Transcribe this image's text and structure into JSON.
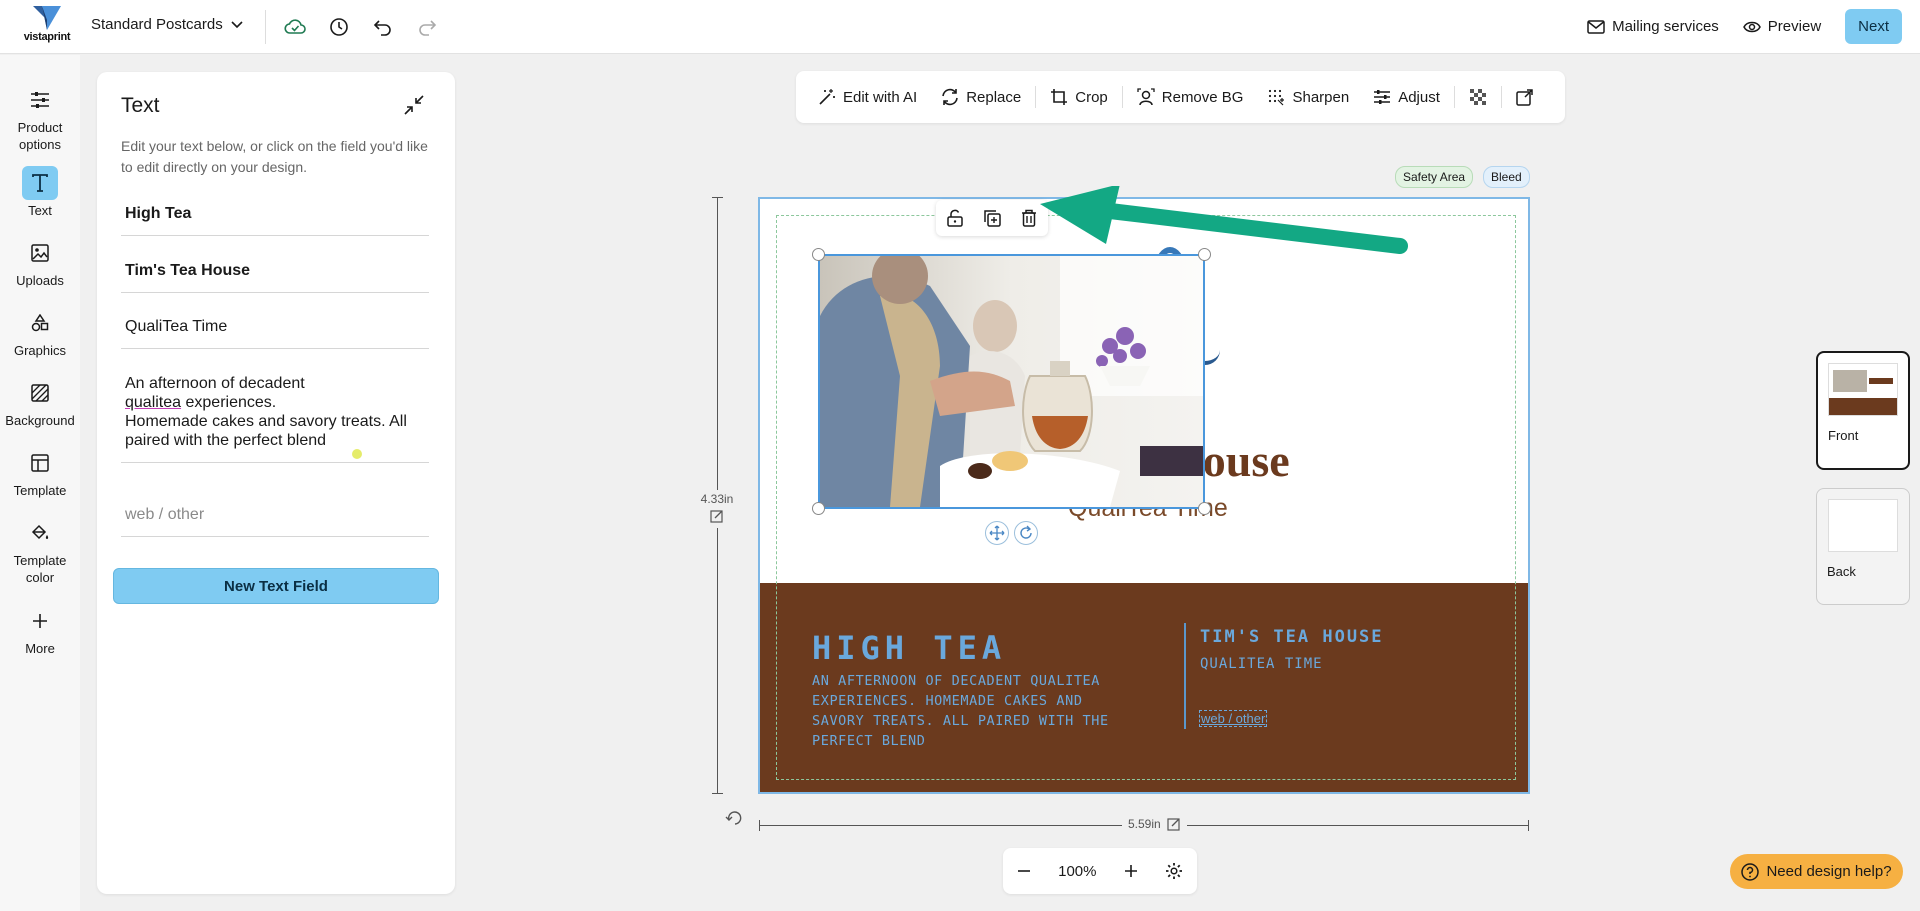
{
  "brand": {
    "name": "vistaprint",
    "accent": "#7fcbf2"
  },
  "header": {
    "project_name": "Standard Postcards",
    "mailing_label": "Mailing services",
    "preview_label": "Preview",
    "next_label": "Next"
  },
  "rail": {
    "items": [
      {
        "label": "Product\noptions",
        "icon": "sliders-icon"
      },
      {
        "label": "Text",
        "icon": "text-icon"
      },
      {
        "label": "Uploads",
        "icon": "image-icon"
      },
      {
        "label": "Graphics",
        "icon": "shapes-icon"
      },
      {
        "label": "Background",
        "icon": "pattern-icon"
      },
      {
        "label": "Template",
        "icon": "layout-icon"
      },
      {
        "label": "Template\ncolor",
        "icon": "paint-bucket-icon"
      },
      {
        "label": "More",
        "icon": "plus-icon"
      }
    ]
  },
  "text_panel": {
    "title": "Text",
    "description": "Edit your text below, or click on the field you'd like to edit directly on your design.",
    "fields": {
      "f1": "High Tea",
      "f2": "Tim's Tea House",
      "f3": "QualiTea Time",
      "f4_part1": "An afternoon of decadent",
      "f4_underlined": "qualitea",
      "f4_part2": " experiences.\nHomemade cakes and savory treats. All paired with the perfect blend",
      "f5_placeholder": "web / other"
    },
    "new_field_label": "New Text Field"
  },
  "image_toolbar": {
    "edit_ai": "Edit with AI",
    "replace": "Replace",
    "crop": "Crop",
    "remove_bg": "Remove BG",
    "sharpen": "Sharpen",
    "adjust": "Adjust"
  },
  "canvas": {
    "safety_label": "Safety Area",
    "bleed_label": "Bleed",
    "height_label": "4.33in",
    "width_label": "5.59in",
    "card": {
      "partial_heading": "louse",
      "partial_subtitle": "QualiTea Time",
      "high_tea": "HIGH TEA",
      "description": "AN AFTERNOON OF DECADENT QUALITEA EXPERIENCES. HOMEMADE CAKES AND SAVORY TREATS. ALL PAIRED WITH THE PERFECT BLEND",
      "house_name": "TIM'S TEA HOUSE",
      "house_tagline": "QUALITEA TIME",
      "web": "web / other"
    }
  },
  "zoom": {
    "level": "100%"
  },
  "pages": {
    "front": "Front",
    "back": "Back"
  },
  "help_label": "Need design help?",
  "annotation_color": "#13a884"
}
